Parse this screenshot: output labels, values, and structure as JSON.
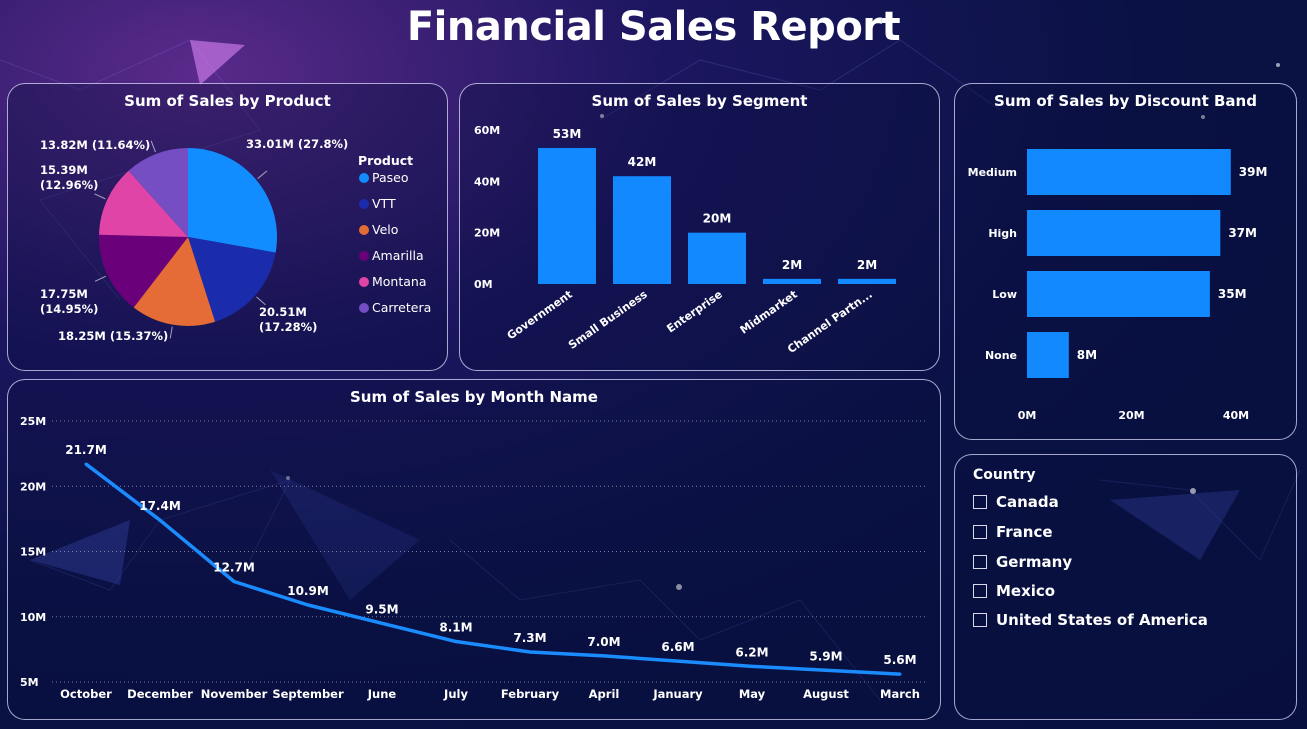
{
  "title": "Financial Sales Report",
  "colors": {
    "bar": "#1289ff",
    "line": "#1a8cff",
    "Paseo": "#118dff",
    "VTT": "#1a2cac",
    "Velo": "#e66c37",
    "Amarilla": "#6b007b",
    "Montana": "#e044a7",
    "Carretera": "#744ec2"
  },
  "product_panel": {
    "title": "Sum of Sales by Product",
    "legend_title": "Product"
  },
  "segment_panel": {
    "title": "Sum of Sales by Segment"
  },
  "discount_panel": {
    "title": "Sum of Sales by Discount Band"
  },
  "month_panel": {
    "title": "Sum of Sales by Month Name"
  },
  "country_slicer": {
    "title": "Country",
    "items": [
      "Canada",
      "France",
      "Germany",
      "Mexico",
      "United States of America"
    ]
  },
  "chart_data": [
    {
      "type": "pie",
      "title": "Sum of Sales by Product",
      "legend_title": "Product",
      "legend_placement": "right",
      "slices": [
        {
          "name": "Paseo",
          "value": 33.01,
          "label": "33.01M (27.8%)"
        },
        {
          "name": "VTT",
          "value": 20.51,
          "label": "20.51M (17.28%)"
        },
        {
          "name": "Velo",
          "value": 18.25,
          "label": "18.25M (15.37%)"
        },
        {
          "name": "Amarilla",
          "value": 17.75,
          "label": "17.75M (14.95%)"
        },
        {
          "name": "Montana",
          "value": 15.39,
          "label": "15.39M (12.96%)"
        },
        {
          "name": "Carretera",
          "value": 13.82,
          "label": "13.82M (11.64%)"
        }
      ]
    },
    {
      "type": "bar",
      "title": "Sum of Sales by Segment",
      "categories": [
        "Government",
        "Small Business",
        "Enterprise",
        "Midmarket",
        "Channel Partn..."
      ],
      "values": [
        53,
        42,
        20,
        2,
        2
      ],
      "data_labels": [
        "53M",
        "42M",
        "20M",
        "2M",
        "2M"
      ],
      "yticks": [
        "0M",
        "20M",
        "40M",
        "60M"
      ],
      "ylim": [
        0,
        60
      ]
    },
    {
      "type": "bar",
      "orientation": "horizontal",
      "title": "Sum of Sales by Discount Band",
      "categories": [
        "Medium",
        "High",
        "Low",
        "None"
      ],
      "values": [
        39,
        37,
        35,
        8
      ],
      "data_labels": [
        "39M",
        "37M",
        "35M",
        "8M"
      ],
      "xticks": [
        "0M",
        "20M",
        "40M"
      ],
      "xlim": [
        0,
        40
      ]
    },
    {
      "type": "line",
      "title": "Sum of Sales by Month Name",
      "categories": [
        "October",
        "December",
        "November",
        "September",
        "June",
        "July",
        "February",
        "April",
        "January",
        "May",
        "August",
        "March"
      ],
      "values": [
        21.7,
        17.4,
        12.7,
        10.9,
        9.5,
        8.1,
        7.3,
        7.0,
        6.6,
        6.2,
        5.9,
        5.6
      ],
      "data_labels": [
        "21.7M",
        "17.4M",
        "12.7M",
        "10.9M",
        "9.5M",
        "8.1M",
        "7.3M",
        "7.0M",
        "6.6M",
        "6.2M",
        "5.9M",
        "5.6M"
      ],
      "yticks": [
        "5M",
        "10M",
        "15M",
        "20M",
        "25M"
      ],
      "ylim": [
        5,
        25
      ],
      "grid": "dotted horizontal"
    }
  ]
}
